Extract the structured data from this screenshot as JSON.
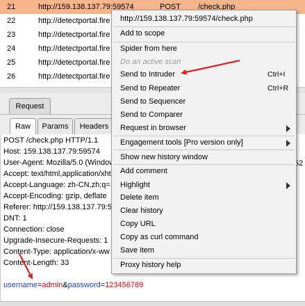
{
  "history": {
    "rows": [
      {
        "num": "21",
        "url": "http://159.138.137.79:59574",
        "method": "POST",
        "path": "/check.php",
        "selected": true
      },
      {
        "num": "22",
        "url": "http://detectportal.fire"
      },
      {
        "num": "23",
        "url": "http://detectportal.fire"
      },
      {
        "num": "24",
        "url": "http://detectportal.fire"
      },
      {
        "num": "25",
        "url": "http://detectportal.fire"
      },
      {
        "num": "26",
        "url": "http://detectportal.fire"
      }
    ]
  },
  "request": {
    "top_tab": "Request",
    "sub_tabs": {
      "raw": "Raw",
      "params": "Params",
      "headers": "Headers"
    },
    "lines": [
      "POST /check.php HTTP/1.1",
      "Host: 159.138.137.79:59574",
      "User-Agent: Mozilla/5.0 (Window",
      "Accept: text/html,application/xht",
      "Accept-Language: zh-CN,zh;q=",
      "Accept-Encoding: gzip, deflate",
      "Referer: http://159.138.137.79:5",
      "DNT: 1",
      "Connection: close",
      "Upgrade-Insecure-Requests: 1",
      "Content-Type: application/x-ww",
      "Content-Length: 33"
    ],
    "body": {
      "key1": "username",
      "eq1": "=",
      "val1": "admin",
      "amp": "&",
      "key2": "password",
      "eq2": "=",
      "val2": "123456789"
    },
    "right_edge_fragment": "52"
  },
  "context_menu": {
    "header": "http://159.138.137.79:59574/check.php",
    "items": {
      "add_to_scope": "Add to scope",
      "spider": "Spider from here",
      "active_scan": "Do an active scan",
      "intruder": "Send to Intruder",
      "intruder_shortcut": "Ctrl+I",
      "repeater": "Send to Repeater",
      "repeater_shortcut": "Ctrl+R",
      "sequencer": "Send to Sequencer",
      "comparer": "Send to Comparer",
      "browser": "Request in browser",
      "engagement": "Engagement tools [Pro version only]",
      "new_history": "Show new history window",
      "add_comment": "Add comment",
      "highlight": "Highlight",
      "delete_item": "Delete item",
      "clear_history": "Clear history",
      "copy_url": "Copy URL",
      "copy_curl": "Copy as curl command",
      "save_item": "Save item",
      "proxy_help": "Proxy history help"
    }
  },
  "colors": {
    "selected_row": "#f6b58a",
    "annotation_arrow": "#e02020",
    "body_key": "#2040c0",
    "body_value": "#d80000"
  }
}
